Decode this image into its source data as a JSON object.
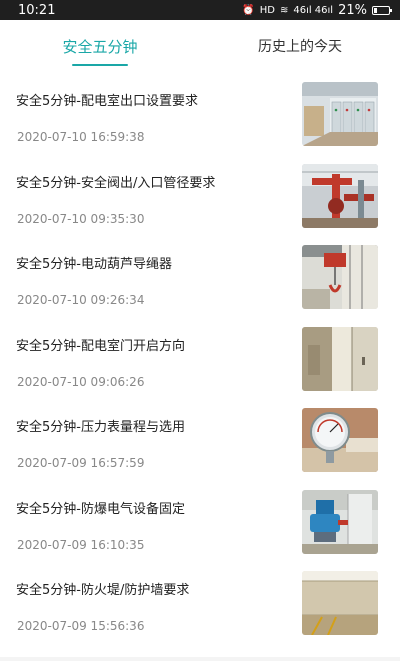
{
  "status_bar": {
    "time": "10:21",
    "indicators": "HD",
    "signal": "46ıl 46ıl",
    "battery_text": "21%",
    "battery_level": 0.21
  },
  "tabs": [
    {
      "label": "安全五分钟",
      "active": true
    },
    {
      "label": "历史上的今天",
      "active": false
    }
  ],
  "articles": [
    {
      "title": "安全5分钟-配电室出口设置要求",
      "date": "2020-07-10 16:59:38",
      "image": "switchgear-room"
    },
    {
      "title": "安全5分钟-安全阀出/入口管径要求",
      "date": "2020-07-10 09:35:30",
      "image": "red-pipe-valve"
    },
    {
      "title": "安全5分钟-电动葫芦导绳器",
      "date": "2020-07-10 09:26:34",
      "image": "electric-hoist"
    },
    {
      "title": "  安全5分钟-配电室门开启方向",
      "date": "2020-07-10 09:06:26",
      "image": "open-door"
    },
    {
      "title": "安全5分钟-压力表量程与选用",
      "date": "2020-07-09 16:57:59",
      "image": "pressure-gauge"
    },
    {
      "title": "安全5分钟-防爆电气设备固定",
      "date": "2020-07-09 16:10:35",
      "image": "explosion-proof-motor"
    },
    {
      "title": "安全5分钟-防火堤/防护墙要求",
      "date": "2020-07-09 15:56:36",
      "image": "fire-dike-wall"
    }
  ]
}
